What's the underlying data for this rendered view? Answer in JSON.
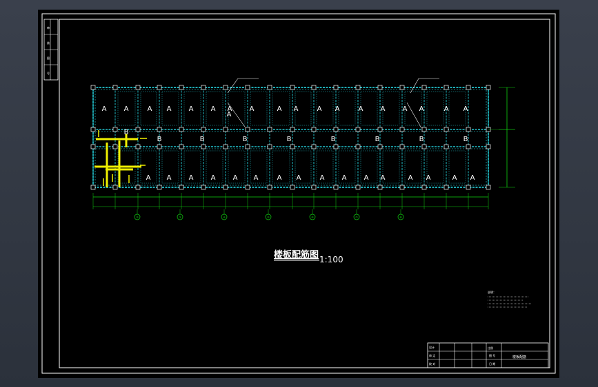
{
  "drawing": {
    "title": "楼板配筋图",
    "scale": "1:100"
  },
  "slabs": {
    "top_row": [
      "A",
      "A",
      "A",
      "A",
      "A",
      "A",
      "A",
      "A",
      "A",
      "A",
      "A",
      "A",
      "A",
      "A",
      "A",
      "A",
      "A",
      "A"
    ],
    "corridor": [
      "B",
      "B",
      "B",
      "B",
      "B",
      "B",
      "B",
      "B"
    ],
    "bottom_row": [
      "A",
      "A",
      "A",
      "A",
      "A",
      "A",
      "A",
      "A",
      "A",
      "A",
      "A",
      "A",
      "A",
      "A",
      "A",
      "A"
    ],
    "left_extra_top": [
      "A",
      "A"
    ],
    "left_b": "B"
  },
  "axes": {
    "bubbles": [
      "②",
      "③",
      "④",
      "⑤",
      "⑥",
      "⑦",
      "⑧"
    ]
  },
  "notes": {
    "heading": "说明："
  },
  "title_block": {
    "scale_label": "比例",
    "drawing_name": "楼板配筋"
  },
  "colors": {
    "background": "#000000",
    "grid": "#29e6f2",
    "dimension": "#11d411",
    "rebar": "#f0f000",
    "text": "#ffffff"
  }
}
